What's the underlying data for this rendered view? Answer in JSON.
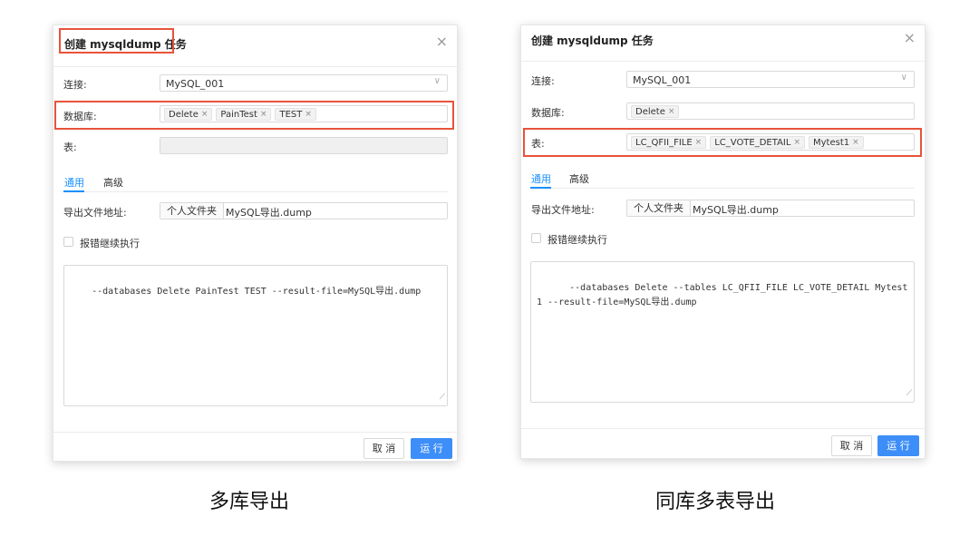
{
  "panels": [
    {
      "title": "创建 mysqldump 任务",
      "labels": {
        "connection": "连接:",
        "database": "数据库:",
        "table": "表:",
        "export_path": "导出文件地址:",
        "continue_on_error": "报错继续执行"
      },
      "connection_value": "MySQL_001",
      "databases": [
        "Delete",
        "PainTest",
        "TEST"
      ],
      "tables": [],
      "tabs": [
        "通用",
        "高级"
      ],
      "path_prefix": "个人文件夹",
      "path_value": "MySQL导出.dump",
      "command": "--databases Delete PainTest TEST --result-file=MySQL导出.dump",
      "buttons": {
        "cancel": "取 消",
        "run": "运 行"
      },
      "caption": "多库导出"
    },
    {
      "title": "创建 mysqldump 任务",
      "labels": {
        "connection": "连接:",
        "database": "数据库:",
        "table": "表:",
        "export_path": "导出文件地址:",
        "continue_on_error": "报错继续执行"
      },
      "connection_value": "MySQL_001",
      "databases": [
        "Delete"
      ],
      "tables": [
        "LC_QFII_FILE",
        "LC_VOTE_DETAIL",
        "Mytest1"
      ],
      "tabs": [
        "通用",
        "高级"
      ],
      "path_prefix": "个人文件夹",
      "path_value": "MySQL导出.dump",
      "command": "  --databases Delete --tables LC_QFII_FILE LC_VOTE_DETAIL Mytest1 --result-file=MySQL导出.dump",
      "buttons": {
        "cancel": "取 消",
        "run": "运 行"
      },
      "caption": "同库多表导出"
    }
  ],
  "icons": {
    "close": "×",
    "chevron_down": "∨",
    "tag_remove": "×",
    "resize": "⟋"
  },
  "colors": {
    "highlight": "#e8533c",
    "accent": "#1890ff",
    "run_button": "#3d8ef8"
  }
}
